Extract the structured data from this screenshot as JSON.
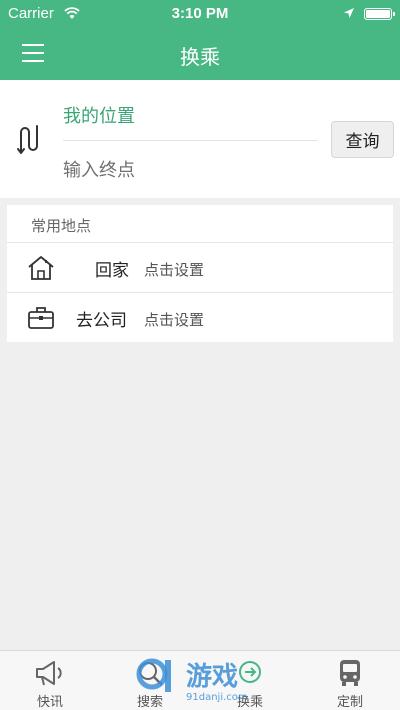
{
  "status_bar": {
    "carrier": "Carrier",
    "time": "3:10 PM"
  },
  "nav": {
    "title": "换乘",
    "menu_icon": "hamburger-menu-icon"
  },
  "route": {
    "origin": "我的位置",
    "destination_placeholder": "输入终点",
    "query_label": "查询",
    "swap_icon": "route-swap-icon"
  },
  "places": {
    "header": "常用地点",
    "items": [
      {
        "name": "回家",
        "hint": "点击设置",
        "icon": "home-icon"
      },
      {
        "name": "去公司",
        "hint": "点击设置",
        "icon": "briefcase-icon"
      }
    ]
  },
  "tabs": [
    {
      "label": "快讯",
      "icon": "megaphone-icon"
    },
    {
      "label": "搜索",
      "icon": "search-icon"
    },
    {
      "label": "换乘",
      "icon": "transfer-icon"
    },
    {
      "label": "定制",
      "icon": "bus-icon"
    }
  ],
  "watermark": {
    "text": "游戏",
    "site": "91danji.com"
  },
  "colors": {
    "brand_green": "#47b784",
    "origin_text": "#3aa676",
    "background": "#efefef"
  }
}
